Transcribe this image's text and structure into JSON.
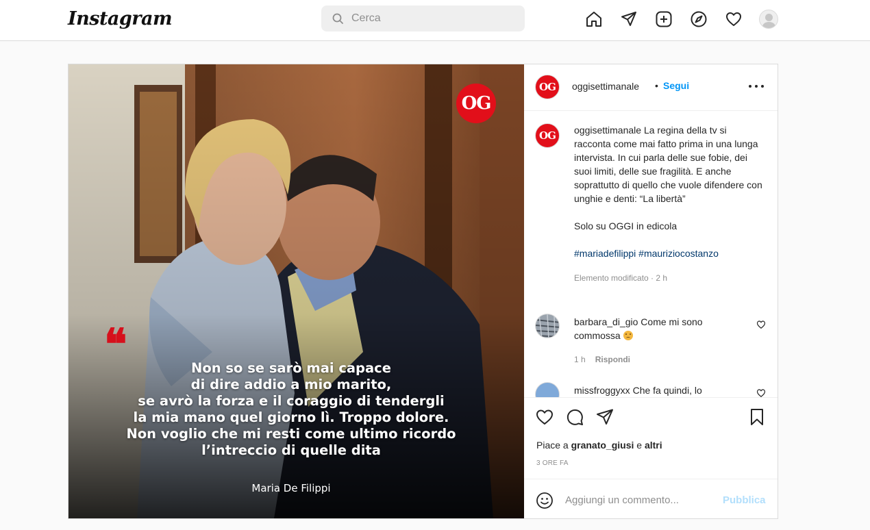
{
  "app": {
    "logo": "Instagram"
  },
  "search": {
    "placeholder": "Cerca"
  },
  "nav": {
    "icons": [
      "home-icon",
      "direct-icon",
      "new-post-icon",
      "explore-icon",
      "activity-icon",
      "profile-avatar"
    ]
  },
  "post": {
    "badge": "OG",
    "quote_mark": "❝",
    "quote_lines": [
      "Non so se sarò mai capace",
      "di dire addio a mio marito,",
      "se avrò la forza e il coraggio di tendergli",
      "la mia mano quel giorno lì. Troppo dolore.",
      "Non voglio che mi resti come ultimo ricordo",
      "l’intreccio di quelle dita"
    ],
    "quote_author": "Maria De Filippi"
  },
  "header": {
    "avatar_text": "OG",
    "username": "oggisettimanale",
    "dot": "•",
    "follow": "Segui"
  },
  "caption": {
    "avatar_text": "OG",
    "username": "oggisettimanale",
    "text": "La regina della tv si racconta come mai fatto prima in una lunga intervista. In cui parla delle sue fobie, dei suoi limiti, delle sue fragilità. E anche soprattutto di quello che vuole difendere con unghie e denti: “La libertà”",
    "text2": "Solo su OGGI in edicola",
    "hashtags": "#mariadefilippi #mauriziocostanzo",
    "meta": "Elemento modificato · 2 h"
  },
  "comments": [
    {
      "username": "barbara_di_gio",
      "text": "Come mi sono commossa",
      "time": "1 h",
      "reply": "Rispondi"
    },
    {
      "username": "missfroggyxx",
      "text": "Che fa quindi, lo"
    }
  ],
  "likes": {
    "prefix": "Piace a",
    "user": "granato_giusi",
    "and": "e",
    "others": "altri"
  },
  "time_ago": "3 ORE FA",
  "add_comment": {
    "placeholder": "Aggiungi un commento...",
    "publish": "Pubblica"
  },
  "colors": {
    "accent": "#0095f6",
    "brand_red": "#e20f1a",
    "hashtag": "#00376b"
  }
}
